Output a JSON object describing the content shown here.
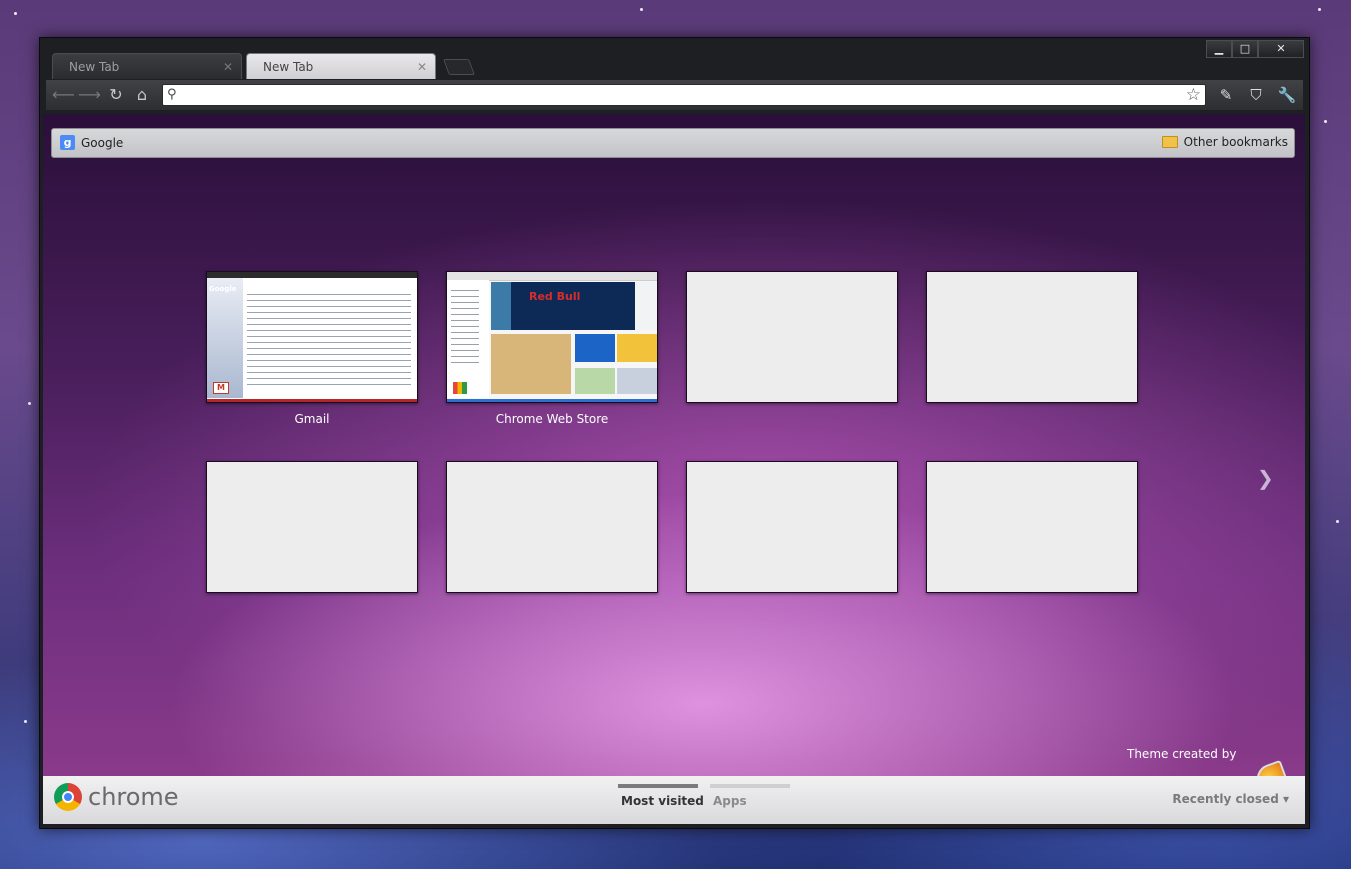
{
  "tabs": [
    {
      "label": "New Tab",
      "active": false
    },
    {
      "label": "New Tab",
      "active": true
    }
  ],
  "window_controls": {
    "minimize": "▁",
    "maximize": "□",
    "close": "✕"
  },
  "toolbar": {
    "back_icon": "back-arrow-icon",
    "forward_icon": "forward-arrow-icon",
    "reload_icon": "reload-icon",
    "home_icon": "home-icon",
    "omnibox_value": "",
    "star_icon": "star-icon",
    "extension_icons": [
      "pen-icon",
      "shield-icon",
      "wrench-icon"
    ]
  },
  "bookmarks_bar": {
    "items": [
      {
        "label": "Google",
        "icon": "google-icon"
      }
    ],
    "other": "Other bookmarks"
  },
  "most_visited": [
    {
      "title": "Gmail",
      "preview": "gmail"
    },
    {
      "title": "Chrome Web Store",
      "preview": "webstore"
    },
    {
      "title": "",
      "preview": "empty"
    },
    {
      "title": "",
      "preview": "empty"
    },
    {
      "title": "",
      "preview": "empty"
    },
    {
      "title": "",
      "preview": "empty"
    },
    {
      "title": "",
      "preview": "empty"
    },
    {
      "title": "",
      "preview": "empty"
    }
  ],
  "previews": {
    "gmail_logo": "Google",
    "webstore_banner": "Red Bull"
  },
  "next_page_icon": "❯",
  "theme_credit": "Theme created by",
  "footer": {
    "brand": "chrome",
    "tabs": [
      {
        "label": "Most visited",
        "active": true
      },
      {
        "label": "Apps",
        "active": false
      }
    ],
    "recently_closed": "Recently closed ▾"
  },
  "colors": {
    "tab_active": "#e0e0e2",
    "frame": "#1d1f22",
    "gmail_red": "#b3262a",
    "webstore_blue": "#2e6fd2"
  }
}
